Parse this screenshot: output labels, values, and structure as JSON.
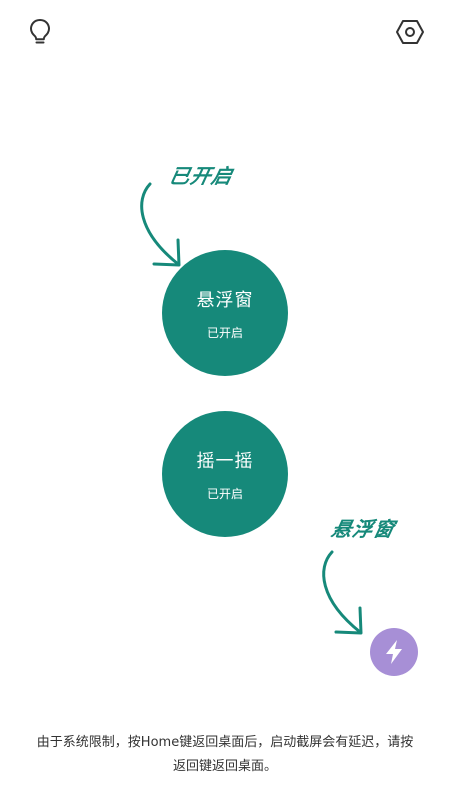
{
  "header": {
    "left_icon": "lightbulb-icon",
    "right_icon": "hexagon-settings-icon"
  },
  "annotations": {
    "opened": "已开启",
    "floating": "悬浮窗"
  },
  "buttons": {
    "float_window": {
      "title": "悬浮窗",
      "status": "已开启"
    },
    "shake": {
      "title": "摇一摇",
      "status": "已开启"
    }
  },
  "floating_ball": {
    "icon": "lightning-icon"
  },
  "notice": "由于系统限制，按Home键返回桌面后，启动截屏会有延迟，请按返回键返回桌面。",
  "colors": {
    "accent": "#16897a",
    "floating_ball": "#a78fd6"
  }
}
